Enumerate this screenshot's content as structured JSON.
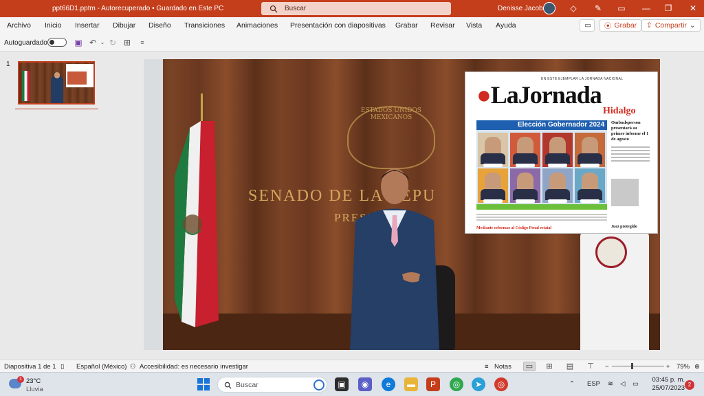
{
  "titlebar": {
    "filename": "ppt66D1.pptm  -  Autorecuperado • Guardado en Este PC",
    "search_placeholder": "Buscar",
    "user_name": "Denisse Jacobo"
  },
  "menu": {
    "items": [
      "Archivo",
      "Inicio",
      "Insertar",
      "Dibujar",
      "Diseño",
      "Transiciones",
      "Animaciones",
      "Presentación con diapositivas",
      "Grabar",
      "Revisar",
      "Vista",
      "Ayuda"
    ],
    "record_button": "Grabar",
    "share_button": "Compartir"
  },
  "qat": {
    "autosave_label": "Autoguardado"
  },
  "thumbnails": {
    "slide_number": "1"
  },
  "slide": {
    "wall_title": "SENADO DE LA REPU",
    "wall_subtitle": "PRESIDENCIA",
    "seal_text": "ESTADOS UNIDOS MEXICANOS",
    "newspaper": {
      "top_line": "EN ESTE EJEMPLAR  LA JORNADA NACIONAL",
      "title": "LaJornada",
      "subtitle": "Hidalgo",
      "banner": "Elección Gobernador 2024",
      "right_headline": "Ombudsperson presentará su primer informe el 1 de agosto",
      "photo_caption": "Juez protegido",
      "bottom_caption": "Mediante reformas al Código Penal estatal"
    }
  },
  "statusbar": {
    "slide_info": "Diapositiva 1 de 1",
    "language": "Español (México)",
    "accessibility": "Accesibilidad: es necesario investigar",
    "notes": "Notas",
    "zoom": "79%"
  },
  "taskbar": {
    "weather_temp": "23°C",
    "weather_desc": "Lluvia",
    "weather_badge": "1",
    "search_placeholder": "Buscar",
    "language": "ESP",
    "time": "03:45 p. m.",
    "date": "25/07/2023",
    "notification_count": "2"
  },
  "colors": {
    "accent": "#c43e1c",
    "newspaper_red": "#d12a1f",
    "banner_blue": "#1f5fb0"
  }
}
